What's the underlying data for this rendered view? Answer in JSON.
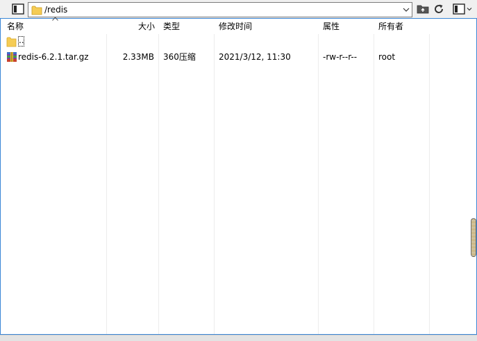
{
  "toolbar": {
    "path": "/redis"
  },
  "columns": {
    "name": "名称",
    "size": "大小",
    "type": "类型",
    "modified": "修改时间",
    "attributes": "属性",
    "owner": "所有者"
  },
  "rows": [
    {
      "name": "..",
      "size": "",
      "type": "",
      "modified": "",
      "attributes": "",
      "owner": "",
      "icon": "folder-icon"
    },
    {
      "name": "redis-6.2.1.tar.gz",
      "size": "2.33MB",
      "type": "360压缩",
      "modified": "2021/3/12, 11:30",
      "attributes": "-rw-r--r--",
      "owner": "root",
      "icon": "archive-icon"
    }
  ],
  "colors": {
    "accent_border": "#3a86d6",
    "folder": "#f5cc55"
  }
}
